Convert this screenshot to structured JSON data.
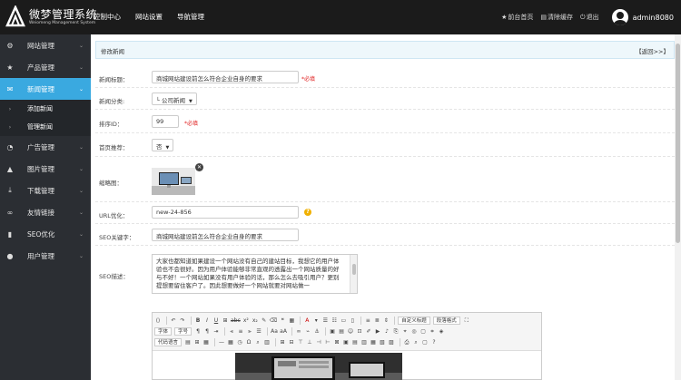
{
  "brand": {
    "title": "微梦管理系统",
    "subtitle": "Weiomeng Management System"
  },
  "topnav": [
    {
      "label": "控制中心"
    },
    {
      "label": "网站设置"
    },
    {
      "label": "导航管理"
    }
  ],
  "topright": {
    "home": "前台首页",
    "clear_cache": "清除缓存",
    "logout": "退出",
    "username": "admin8080"
  },
  "sidebar": {
    "items": [
      {
        "label": "网站管理",
        "icon": "gear-icon"
      },
      {
        "label": "产品管理",
        "icon": "star-icon"
      },
      {
        "label": "新闻管理",
        "icon": "envelope-icon",
        "active": true
      },
      {
        "label": "广告管理",
        "icon": "pie-icon"
      },
      {
        "label": "图片管理",
        "icon": "picture-icon"
      },
      {
        "label": "下载管理",
        "icon": "download-icon"
      },
      {
        "label": "友情链接",
        "icon": "link-icon"
      },
      {
        "label": "SEO优化",
        "icon": "bar-chart-icon"
      },
      {
        "label": "用户管理",
        "icon": "user-icon"
      }
    ],
    "subitems": [
      {
        "label": "添加新闻"
      },
      {
        "label": "管理新闻"
      }
    ]
  },
  "panel": {
    "title": "修改新闻",
    "back": "【返回>>】"
  },
  "form": {
    "title_label": "新闻标题：",
    "title_value": "商城网站建设前怎么符合企业自身的要求",
    "required": "*必填",
    "category_label": "新闻分类:",
    "category_value": "└ 公司新闻",
    "sort_label": "排序ID：",
    "sort_value": "99",
    "home_label": "首页推荐：",
    "home_value": "否",
    "thumb_label": "缩略图：",
    "url_label": "URL优化：",
    "url_value": "new-24-856",
    "keywords_label": "SEO关键字：",
    "keywords_value": "商城网站建设前怎么符合企业自身的要求",
    "desc_label": "SEO描述：",
    "desc_value": "大家也都知道如果建设一个网站没有自己的建站目标，我想它的用户体验也不会很好。因为用户体验能够非常直观的透露出一个网站质量的好与不好！一个网站如果没有用户体验的话，那么怎么去吸引用户？更别提想要留住客户了。因此想要做好一个网站就要对网站做一"
  },
  "editor": {
    "style_select": "字体",
    "size_select": "字号",
    "custom_title": "自定义标题",
    "paragraph": "段落格式",
    "code_lang": "代码语言"
  }
}
